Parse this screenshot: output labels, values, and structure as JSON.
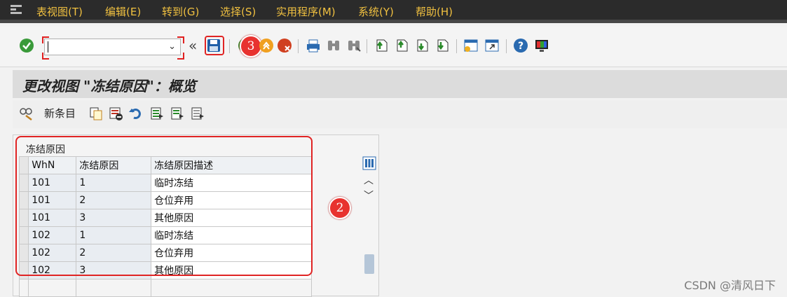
{
  "menu": {
    "items": [
      {
        "label": "表视图(T)"
      },
      {
        "label": "编辑(E)"
      },
      {
        "label": "转到(G)"
      },
      {
        "label": "选择(S)"
      },
      {
        "label": "实用程序(M)"
      },
      {
        "label": "系统(Y)"
      },
      {
        "label": "帮助(H)"
      }
    ]
  },
  "toolbar": {
    "command_field_value": "",
    "expand_glyph": "«",
    "step_marker": "3"
  },
  "title": {
    "text": "更改视图 \"冻结原因\"：概览"
  },
  "app_toolbar": {
    "new_entries_label": "新条目"
  },
  "table": {
    "panel_title": "冻结原因",
    "columns": [
      "WhN",
      "冻结原因",
      "冻结原因描述"
    ],
    "rows": [
      [
        "101",
        "1",
        "临时冻结"
      ],
      [
        "101",
        "2",
        "仓位弃用"
      ],
      [
        "101",
        "3",
        "其他原因"
      ],
      [
        "102",
        "1",
        "临时冻结"
      ],
      [
        "102",
        "2",
        "仓位弃用"
      ],
      [
        "102",
        "3",
        "其他原因"
      ]
    ],
    "step_marker": "2"
  },
  "watermark": "CSDN @清风日下",
  "colors": {
    "menu_bg": "#2b2b2b",
    "menu_text": "#f0c040",
    "highlight_red": "#e02424",
    "key_cell_bg": "#e9edf2"
  }
}
